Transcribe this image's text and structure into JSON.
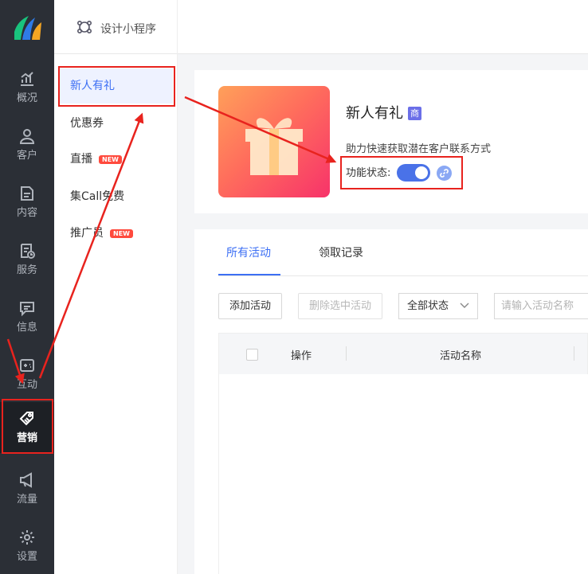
{
  "app": {
    "brand_label": "设计小程序"
  },
  "rail": {
    "items": [
      {
        "label": "概况",
        "icon": "chart-icon"
      },
      {
        "label": "客户",
        "icon": "user-icon"
      },
      {
        "label": "内容",
        "icon": "document-icon"
      },
      {
        "label": "服务",
        "icon": "service-icon"
      },
      {
        "label": "信息",
        "icon": "message-icon"
      },
      {
        "label": "互动",
        "icon": "interaction-icon"
      },
      {
        "label": "营销",
        "icon": "tag-icon",
        "active": true
      },
      {
        "label": "流量",
        "icon": "megaphone-icon"
      },
      {
        "label": "设置",
        "icon": "settings-icon"
      }
    ]
  },
  "subnav": {
    "items": [
      {
        "label": "新人有礼",
        "active": true
      },
      {
        "label": "优惠券"
      },
      {
        "label": "直播",
        "badge": "NEW"
      },
      {
        "label": "集Call免费"
      },
      {
        "label": "推广员",
        "badge": "NEW"
      }
    ]
  },
  "feature": {
    "title": "新人有礼",
    "badge": "商",
    "description": "助力快速获取潜在客户联系方式",
    "status_label": "功能状态:",
    "enabled": true
  },
  "tabs": [
    {
      "label": "所有活动",
      "active": true
    },
    {
      "label": "领取记录"
    }
  ],
  "toolbar": {
    "add_label": "添加活动",
    "delete_label": "删除选中活动",
    "status_select": "全部状态",
    "search_placeholder": "请输入活动名称"
  },
  "table": {
    "headers": [
      "操作",
      "活动名称"
    ]
  },
  "colors": {
    "accent": "#3c6ff4",
    "annotation": "#e8231e",
    "rail_bg": "#2b2f36",
    "new_badge": "#ff4a3d"
  }
}
